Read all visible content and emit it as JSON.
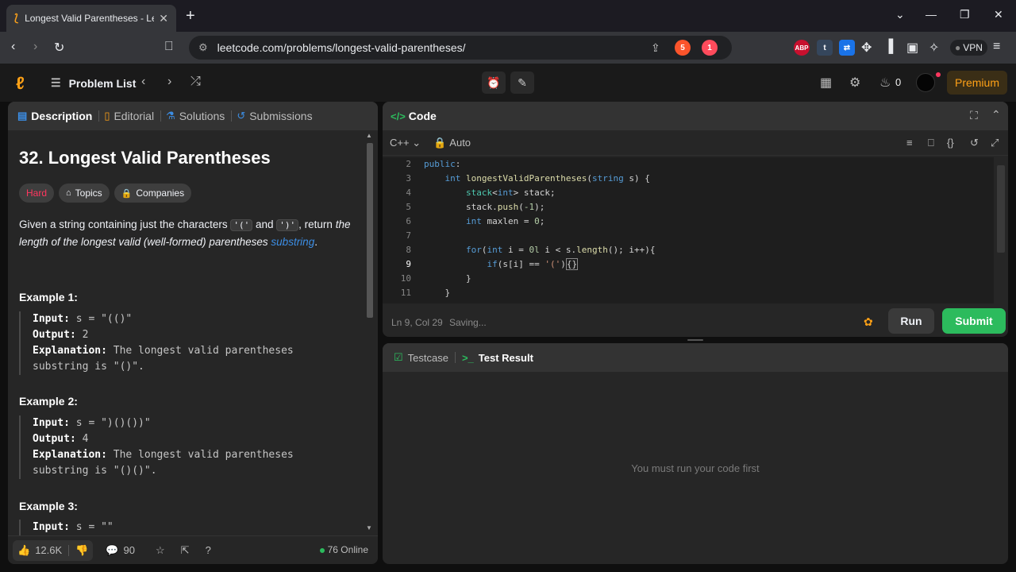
{
  "browser": {
    "tab_title": "Longest Valid Parentheses - Lee",
    "url": "leetcode.com/problems/longest-valid-parentheses/",
    "brave_badge": "5",
    "rewards_badge": "1",
    "vpn_label": "VPN",
    "abp_label": "ABP",
    "t_label": "t"
  },
  "header": {
    "problem_list": "Problem List",
    "streak_count": "0",
    "premium_label": "Premium"
  },
  "left": {
    "tabs": [
      {
        "label": "Description"
      },
      {
        "label": "Editorial"
      },
      {
        "label": "Solutions"
      },
      {
        "label": "Submissions"
      }
    ],
    "title": "32. Longest Valid Parentheses",
    "difficulty": "Hard",
    "topics_label": "Topics",
    "companies_label": "Companies",
    "desc": {
      "p1": "Given a string containing just the characters ",
      "c1": "'('",
      "p2": " and ",
      "c2": "')'",
      "p3": ", return ",
      "p4": "the length of the longest valid (well-formed) parentheses ",
      "link": "substring",
      "p5": "."
    },
    "examples": [
      {
        "heading": "Example 1:",
        "input_label": "Input:",
        "input": " s = \"(()\"",
        "output_label": "Output:",
        "output": " 2",
        "expl_label": "Explanation:",
        "expl": " The longest valid parentheses",
        "expl2": "substring is \"()\"."
      },
      {
        "heading": "Example 2:",
        "input_label": "Input:",
        "input": " s = \")()())\"",
        "output_label": "Output:",
        "output": " 4",
        "expl_label": "Explanation:",
        "expl": " The longest valid parentheses",
        "expl2": "substring is \"()()\"."
      },
      {
        "heading": "Example 3:",
        "input_label": "Input:",
        "input": " s = \"\""
      }
    ],
    "footer": {
      "likes": "12.6K",
      "comments": "90",
      "online": "76 Online"
    }
  },
  "code": {
    "tab_label": "Code",
    "language": "C++",
    "auto_label": "Auto",
    "cursor_pos": "Ln 9, Col 29",
    "saving": "Saving...",
    "run_label": "Run",
    "submit_label": "Submit",
    "lines": [
      {
        "n": "2"
      },
      {
        "n": "3"
      },
      {
        "n": "4"
      },
      {
        "n": "5"
      },
      {
        "n": "6"
      },
      {
        "n": "7"
      },
      {
        "n": "8"
      },
      {
        "n": "9"
      },
      {
        "n": "10"
      },
      {
        "n": "11"
      }
    ]
  },
  "result": {
    "testcase_label": "Testcase",
    "test_result_label": "Test Result",
    "empty_message": "You must run your code first"
  }
}
